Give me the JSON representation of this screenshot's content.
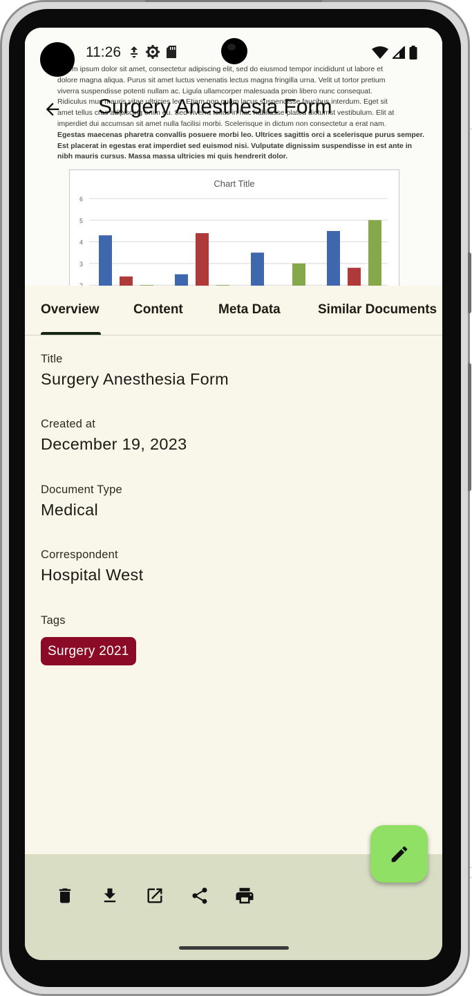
{
  "status_bar": {
    "time": "11:26"
  },
  "app_bar": {
    "title": "Surgery Anesthesia Form"
  },
  "preview": {
    "text_lines": [
      "Lorem ipsum dolor sit amet, consectetur adipiscing elit, sed do eiusmod tempor incididunt ut labore et",
      "dolore magna aliqua. Purus sit amet luctus venenatis lectus magna fringilla urna. Velit ut tortor pretium",
      "viverra suspendisse potenti nullam ac. Ligula ullamcorper malesuada proin libero nunc consequat.",
      "Ridiculus mus mauris vitae ultricies leo. Etiam non quam lacus suspendisse faucibus interdum. Eget sit",
      "amet tellus cras adipiscing enim eu. Sed viverra tellus in hac habitasse platea dictumst vestibulum. Elit at",
      "imperdiet dui accumsan sit amet nulla facilisi morbi. Scelerisque in dictum non consectetur a erat nam.",
      "Egestas maecenas pharetra convallis posuere morbi leo. Ultrices sagittis orci a scelerisque purus semper.",
      "Est placerat in egestas erat imperdiet sed euismod nisi. Vulputate dignissim suspendisse in est ante in",
      "nibh mauris cursus. Massa massa ultricies mi quis hendrerit dolor."
    ],
    "chart": {
      "title": "Chart Title",
      "y_ticks": [
        "6",
        "5",
        "4",
        "3",
        "2"
      ],
      "ylim": [
        2,
        6
      ],
      "groups": [
        [
          4.3,
          2.4,
          2.0
        ],
        [
          2.5,
          4.4,
          2.0
        ],
        [
          3.5,
          1.8,
          3.0
        ],
        [
          4.5,
          2.8,
          5.0
        ]
      ],
      "colors": [
        "#3f67ad",
        "#b03a3a",
        "#85a94a"
      ]
    }
  },
  "tabs": [
    {
      "label": "Overview",
      "active": true
    },
    {
      "label": "Content"
    },
    {
      "label": "Meta Data"
    },
    {
      "label": "Similar Documents"
    }
  ],
  "overview": {
    "title_label": "Title",
    "title_value": "Surgery Anesthesia Form",
    "created_label": "Created at",
    "created_value": "December 19, 2023",
    "type_label": "Document Type",
    "type_value": "Medical",
    "correspondent_label": "Correspondent",
    "correspondent_value": "Hospital West",
    "tags_label": "Tags",
    "tags": [
      "Surgery 2021"
    ]
  },
  "actions": [
    "delete-icon",
    "download-icon",
    "open-external-icon",
    "share-icon",
    "print-icon"
  ],
  "fab": {
    "icon": "edit-icon"
  },
  "colors": {
    "tag": "#8b0a25",
    "fab": "#8fe064",
    "bottom_bar": "#d8ddc4",
    "background": "#f9f7e9"
  }
}
